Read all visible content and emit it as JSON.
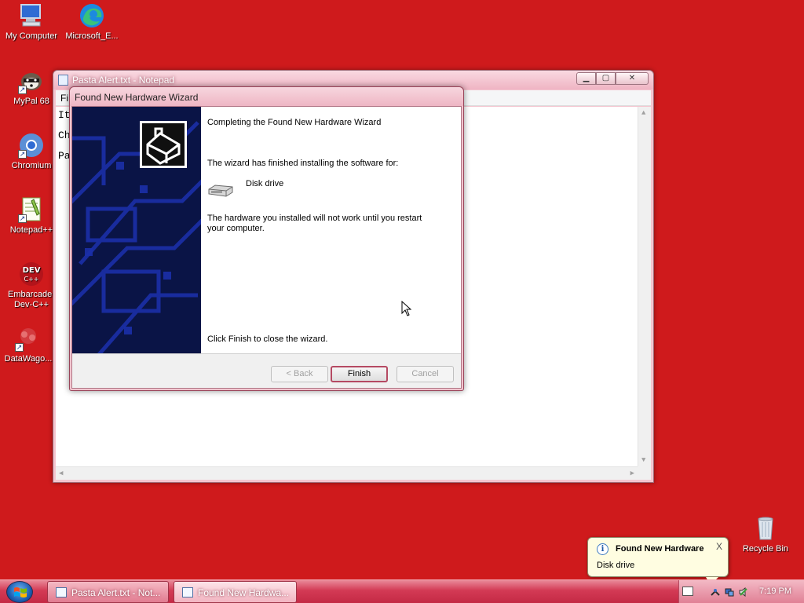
{
  "desktop": {
    "icons": [
      {
        "label": "My Computer",
        "icon": "computer-icon"
      },
      {
        "label": "Microsoft_E...",
        "icon": "edge-icon"
      },
      {
        "label": "MyPal 68",
        "icon": "mypal-icon"
      },
      {
        "label": "Chromium",
        "icon": "chromium-icon"
      },
      {
        "label": "Notepad++",
        "icon": "notepadpp-icon"
      },
      {
        "label": "Embarcadero Dev-C++",
        "label_line1": "Embarcader",
        "label_line2": "Dev-C++",
        "icon": "devcpp-icon"
      },
      {
        "label": "DataWago...",
        "icon": "datawagon-icon"
      },
      {
        "label": "Recycle Bin",
        "icon": "recycle-bin-icon"
      }
    ],
    "background_color": "#cf1a1c"
  },
  "notepad": {
    "title": "Pasta Alert.txt - Notepad",
    "menu_first": "Fi",
    "lines": [
      "It",
      "Ch",
      "Pa"
    ]
  },
  "wizard": {
    "title": "Found New Hardware Wizard",
    "heading": "Completing the Found New Hardware Wizard",
    "finished_text": "The wizard has finished installing the software for:",
    "device_name": "Disk drive",
    "restart_line1": "The hardware you installed will not work until you restart",
    "restart_line2": "your computer.",
    "close_hint": "Click Finish to close the wizard.",
    "buttons": {
      "back": "< Back",
      "finish": "Finish",
      "cancel": "Cancel"
    }
  },
  "balloon": {
    "title": "Found New Hardware",
    "text": "Disk drive",
    "close": "X"
  },
  "taskbar": {
    "tasks": [
      {
        "label": "Pasta Alert.txt - Not...",
        "active": false
      },
      {
        "label": "Found New Hardwa...",
        "active": true
      }
    ],
    "clock": "7:19 PM"
  },
  "colors": {
    "accent": "#d33a55",
    "wizard_sidebar": "#0a1446"
  }
}
